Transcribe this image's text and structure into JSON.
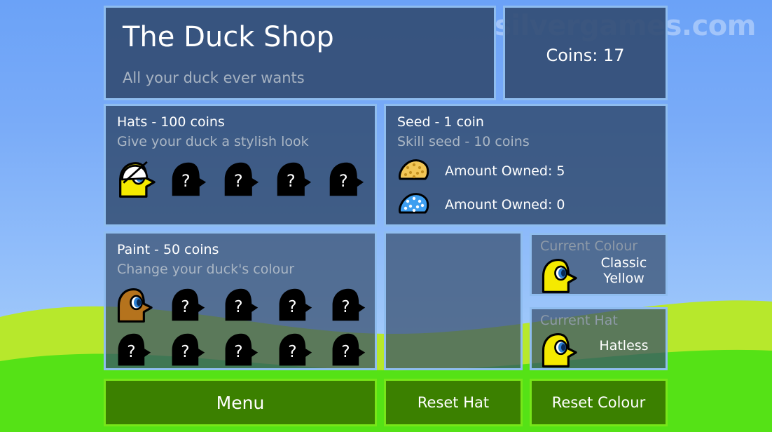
{
  "watermark": "silvergames.com",
  "header": {
    "title": "The Duck Shop",
    "subtitle": "All your duck ever wants"
  },
  "coins": {
    "label": "Coins: 17"
  },
  "hats": {
    "title": "Hats - 100 coins",
    "subtitle": "Give your duck a stylish look",
    "slots": [
      {
        "state": "owned",
        "label": "",
        "duck_color": "#f5ea00",
        "hat": "white-cap"
      },
      {
        "state": "locked",
        "label": "?"
      },
      {
        "state": "locked",
        "label": "?"
      },
      {
        "state": "locked",
        "label": "?"
      },
      {
        "state": "locked",
        "label": "?"
      }
    ]
  },
  "seed": {
    "title": "Seed - 1 coin",
    "subtitle": "Skill seed - 10 coins",
    "rows": [
      {
        "icon": "seed-pile-gold",
        "color": "#f2c656",
        "label": "Amount Owned: 5"
      },
      {
        "icon": "seed-pile-blue",
        "color": "#3f9ff0",
        "label": "Amount Owned: 0"
      }
    ]
  },
  "paint": {
    "title": "Paint - 50 coins",
    "subtitle": "Change your duck's colour",
    "row1": [
      {
        "state": "owned",
        "label": "",
        "duck_color": "#b5731d"
      },
      {
        "state": "locked",
        "label": "?"
      },
      {
        "state": "locked",
        "label": "?"
      },
      {
        "state": "locked",
        "label": "?"
      },
      {
        "state": "locked",
        "label": "?"
      }
    ],
    "row2": [
      {
        "state": "locked",
        "label": "?"
      },
      {
        "state": "locked",
        "label": "?"
      },
      {
        "state": "locked",
        "label": "?"
      },
      {
        "state": "locked",
        "label": "?"
      },
      {
        "state": "locked",
        "label": "?"
      }
    ]
  },
  "current_colour": {
    "title": "Current Colour",
    "value": "Classic Yellow",
    "duck_color": "#f5ea00"
  },
  "current_hat": {
    "title": "Current Hat",
    "value": "Hatless",
    "duck_color": "#f5ea00"
  },
  "buttons": {
    "menu": "Menu",
    "reset_hat": "Reset Hat",
    "reset_colour": "Reset Colour"
  },
  "colors": {
    "sky_top": "#6ba2f7",
    "sky_bottom": "#b2d6fc",
    "hill_light": "#b7e82c",
    "hill_bright": "#55e216",
    "panel_bg": "#2d4669",
    "panel_border": "#8fbdef",
    "button_bg": "#3b8000",
    "button_border": "#77e619",
    "duck_yellow": "#f5ea00",
    "duck_brown": "#b5731d"
  }
}
